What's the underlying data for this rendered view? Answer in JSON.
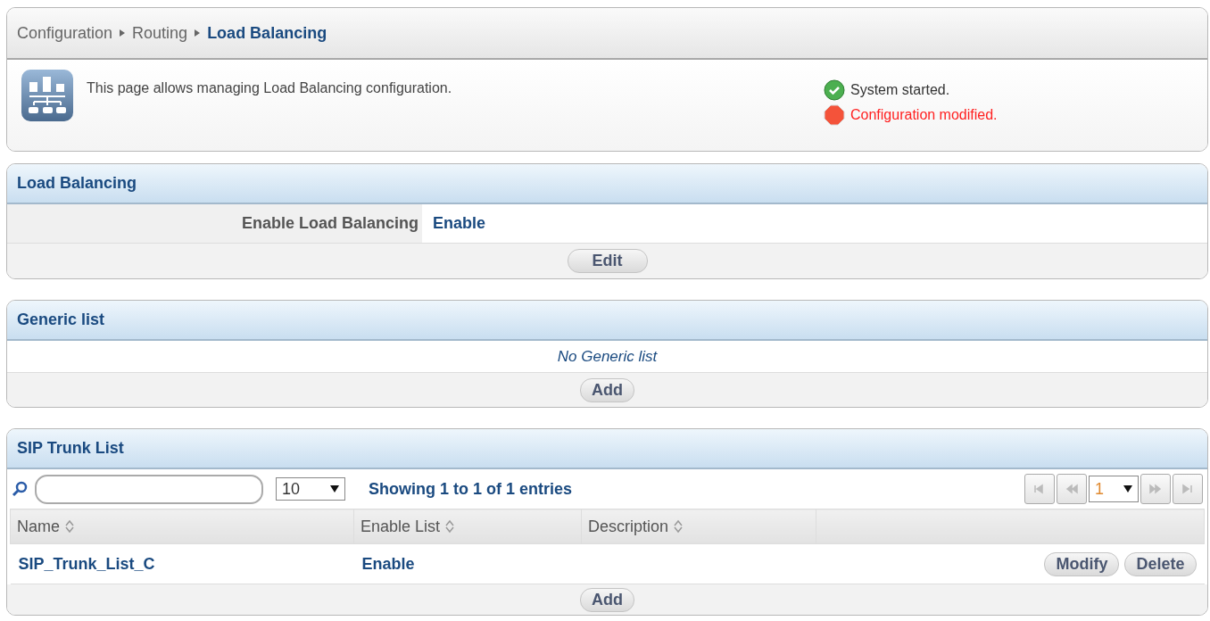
{
  "breadcrumb": [
    {
      "label": "Configuration",
      "current": false
    },
    {
      "label": "Routing",
      "current": false
    },
    {
      "label": "Load Balancing",
      "current": true
    }
  ],
  "intro": {
    "text": "This page allows managing Load Balancing configuration."
  },
  "status": [
    {
      "kind": "ok",
      "text": "System started."
    },
    {
      "kind": "error",
      "text": "Configuration modified."
    }
  ],
  "load_balancing": {
    "title": "Load Balancing",
    "label": "Enable Load Balancing",
    "value": "Enable",
    "button": "Edit"
  },
  "generic_list": {
    "title": "Generic list",
    "empty": "No Generic list",
    "button": "Add"
  },
  "sip_trunk_list": {
    "title": "SIP Trunk List",
    "page_size": "10",
    "info": "Showing **1** to **1** of **1** entries",
    "page": "1",
    "columns": [
      "Name",
      "Enable List",
      "Description"
    ],
    "rows": [
      {
        "name": "SIP_Trunk_List_C",
        "enable": "Enable",
        "actions": [
          "Modify",
          "Delete"
        ]
      }
    ],
    "button": "Add"
  }
}
